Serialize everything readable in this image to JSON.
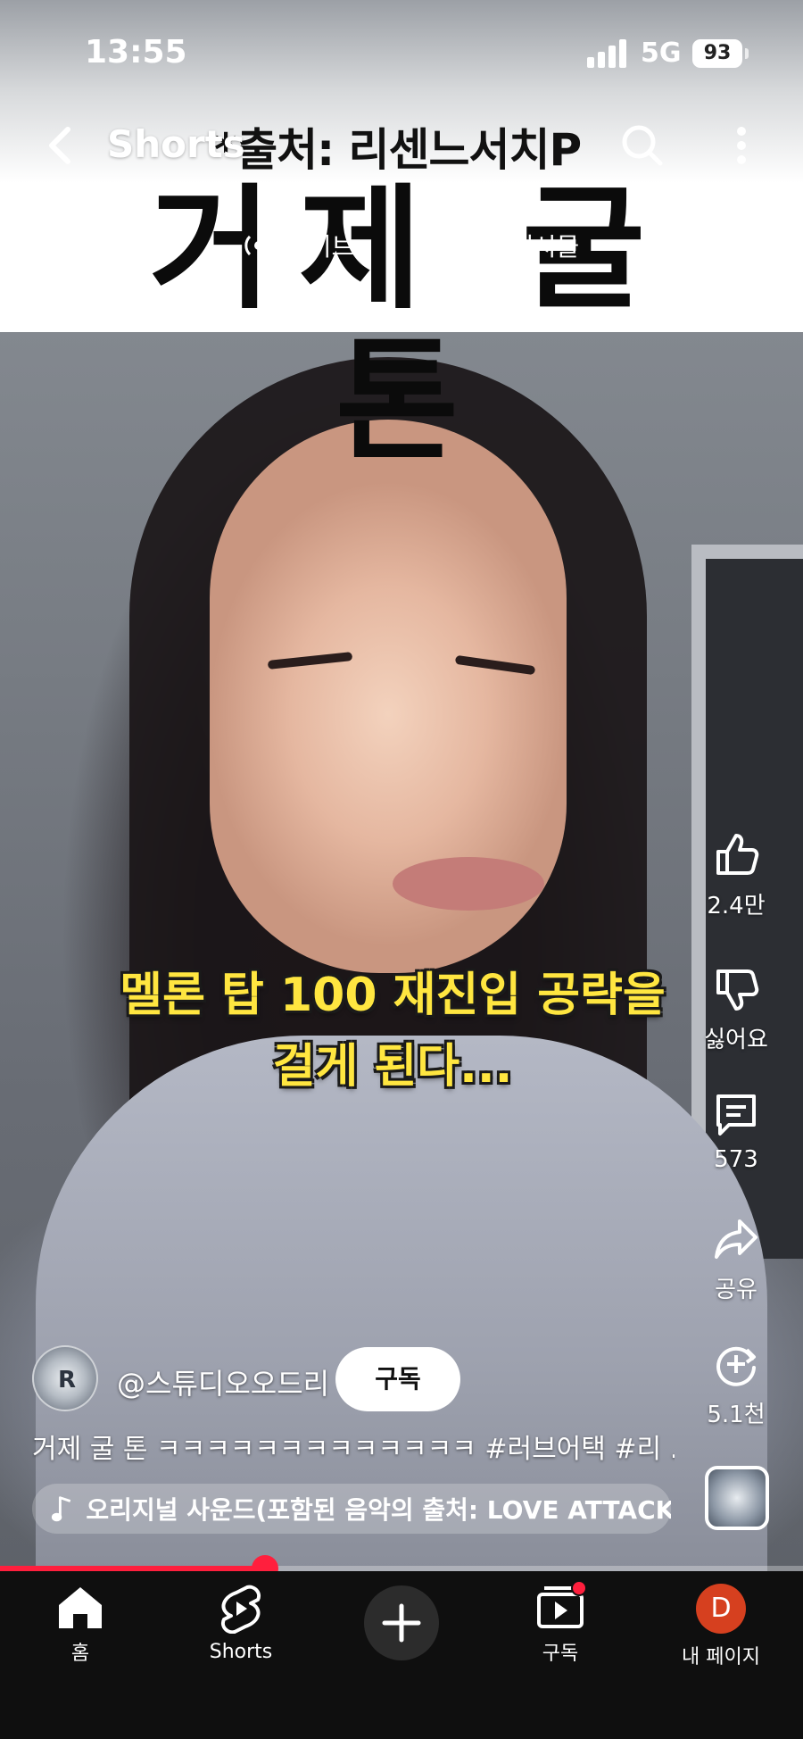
{
  "status_bar": {
    "time": "13:55",
    "network": "5G",
    "battery": "93"
  },
  "header": {
    "title": "Shorts"
  },
  "overlay": {
    "source": "*출처: 리센느서치P",
    "big_title": "거제 굴 톤"
  },
  "chips": {
    "live": "라이브",
    "posts": "게시물"
  },
  "caption": {
    "line1": "멜론 탑 100 재진입 공략을",
    "line2": "걸게 된다..."
  },
  "actions": {
    "like_count": "2.4만",
    "dislike_label": "싫어요",
    "comment_count": "573",
    "share_label": "공유",
    "remix_count": "5.1천"
  },
  "channel": {
    "avatar_mark": "R",
    "handle": "@스튜디오오드리",
    "subscribe_label": "구독",
    "description": "거제 굴 톤 ㅋㅋㅋㅋㅋㅋㅋㅋㅋㅋㅋㅋㅋ #러브어택 #리 ...",
    "music": "오리지널 사운드(포함된 음악의 출처: LOVE ATTACK..."
  },
  "progress": {
    "fraction": 0.33
  },
  "nav": {
    "home": "홈",
    "shorts": "Shorts",
    "subscriptions": "구독",
    "profile_initial": "D",
    "profile": "내 페이지"
  },
  "colors": {
    "accent": "#ff1f3d",
    "caption_yellow": "#ffe640",
    "profile_avatar": "#d6401f"
  }
}
